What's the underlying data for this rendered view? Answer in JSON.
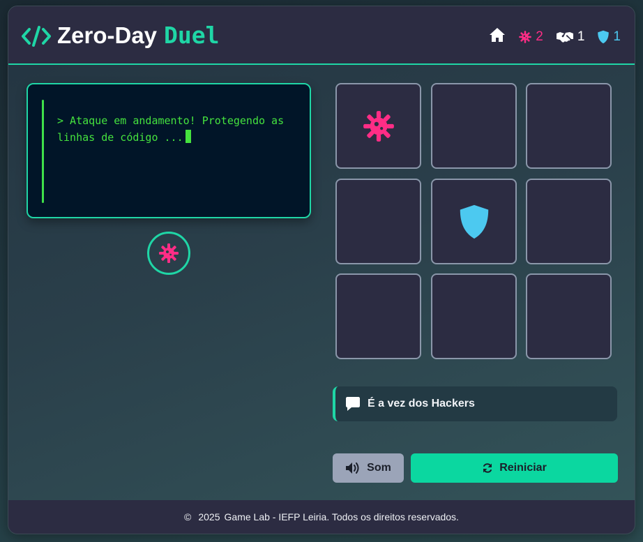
{
  "header": {
    "title_main": "Zero-Day",
    "title_accent": "Duel",
    "stats": {
      "hackers_wins": "2",
      "draws": "1",
      "defenders_wins": "1"
    }
  },
  "terminal": {
    "message": "> Ataque em andamento! Protegendo as linhas de código ..."
  },
  "turn_indicator": {
    "icon": "virus-icon"
  },
  "board": {
    "cells": [
      "virus",
      "",
      "",
      "",
      "shield",
      "",
      "",
      "",
      ""
    ]
  },
  "status": {
    "text": "É a vez dos Hackers"
  },
  "buttons": {
    "sound_label": "Som",
    "restart_label": "Reiniciar"
  },
  "footer": {
    "copyright_symbol": "©",
    "year": "2025",
    "text": "Game Lab - IEFP Leiria. Todos os direitos reservados."
  },
  "colors": {
    "accent": "#1fd6a6",
    "hacker": "#ff2d86",
    "defender": "#4cc9f0",
    "terminal_text": "#45e23e"
  }
}
